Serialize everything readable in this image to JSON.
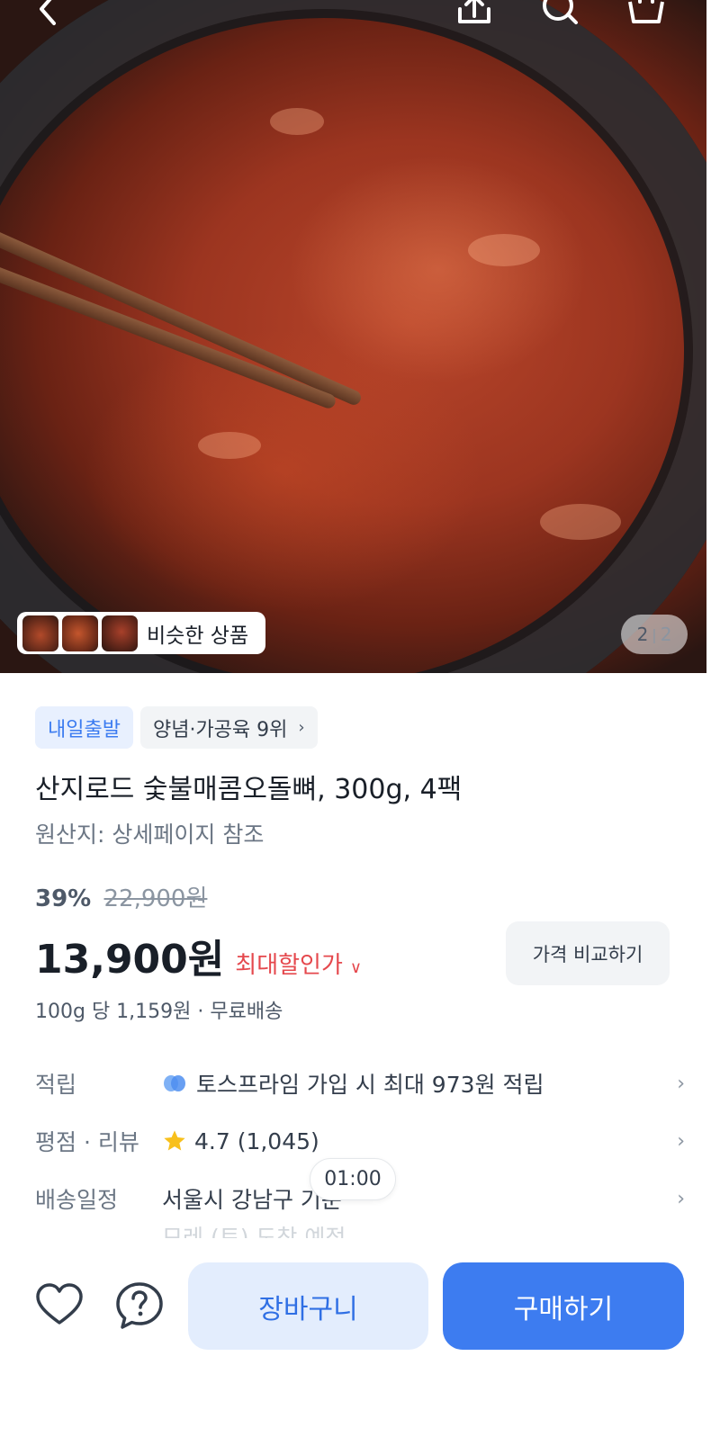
{
  "hero": {
    "similar_label": "비슷한 상품",
    "page_current": "2",
    "page_total": "2"
  },
  "product": {
    "badge_delivery": "내일출발",
    "badge_rank": "양념·가공육 9위",
    "title": "산지로드 숯불매콤오돌뼈, 300g, 4팩",
    "origin": "원산지: 상세페이지 참조",
    "discount_pct": "39%",
    "original_price": "22,900원",
    "price": "13,900원",
    "max_discount_label": "최대할인가",
    "compare_button": "가격 비교하기",
    "unit_price": "100g 당 1,159원 · 무료배송"
  },
  "details": {
    "points_label": "적립",
    "points_value": "토스프라임 가입 시 최대 973원 적립",
    "rating_label": "평점 · 리뷰",
    "rating_value": "4.7 (1,045)",
    "delivery_label": "배송일정",
    "delivery_value": "서울시 강남구 기준",
    "delivery_sub": "모레 (토) 도착 예정",
    "timer": "01:00"
  },
  "bottom": {
    "cart_button": "장바구니",
    "buy_button": "구매하기"
  },
  "colors": {
    "accent": "#3d7cf0",
    "accent_light": "#e3edfd",
    "discount_red": "#e5484d",
    "star": "#f8c01c"
  },
  "icons": [
    "back-icon",
    "share-icon",
    "search-icon",
    "cart-icon",
    "prime-icon",
    "star-icon",
    "chevron-right-icon",
    "heart-icon",
    "question-icon"
  ]
}
